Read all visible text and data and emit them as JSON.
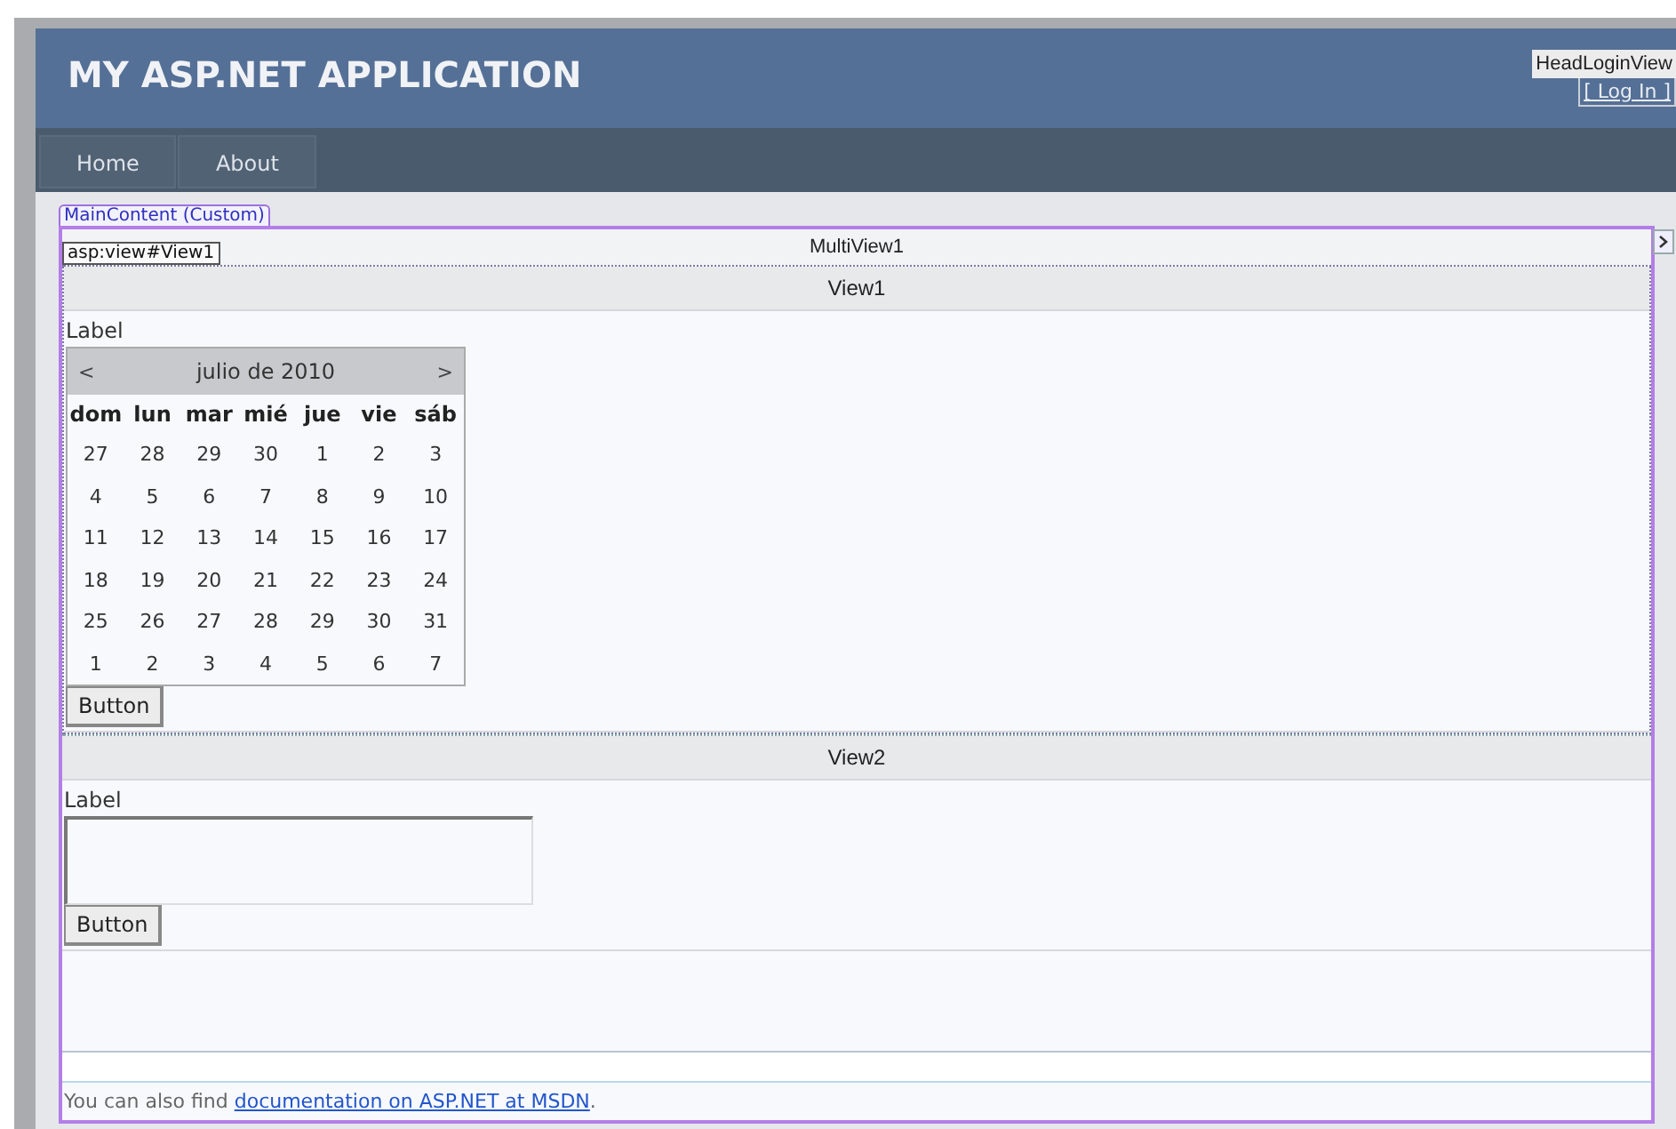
{
  "header": {
    "title": "MY ASP.NET APPLICATION",
    "login_view": {
      "tag": "HeadLoginView",
      "link": "[ Log In ]"
    }
  },
  "nav": [
    {
      "label": "Home"
    },
    {
      "label": "About"
    }
  ],
  "content_tag": "MainContent (Custom)",
  "multiview": {
    "title": "MultiView1",
    "tag": "asp:view#View1",
    "views": [
      {
        "title": "View1",
        "items": [
          {
            "kind": "label",
            "text": "Label"
          },
          {
            "kind": "calendar",
            "prev": "<",
            "month": "julio de 2010",
            "next": ">",
            "days": [
              "dom",
              "lun",
              "mar",
              "mié",
              "jue",
              "vie",
              "sáb"
            ],
            "weeks": [
              [
                "27",
                "28",
                "29",
                "30",
                "1",
                "2",
                "3"
              ],
              [
                "4",
                "5",
                "6",
                "7",
                "8",
                "9",
                "10"
              ],
              [
                "11",
                "12",
                "13",
                "14",
                "15",
                "16",
                "17"
              ],
              [
                "18",
                "19",
                "20",
                "21",
                "22",
                "23",
                "24"
              ],
              [
                "25",
                "26",
                "27",
                "28",
                "29",
                "30",
                "31"
              ],
              [
                "1",
                "2",
                "3",
                "4",
                "5",
                "6",
                "7"
              ]
            ]
          },
          {
            "kind": "button",
            "label": "Button"
          }
        ]
      },
      {
        "title": "View2",
        "items": [
          {
            "kind": "label",
            "text": "Label"
          },
          {
            "kind": "textarea"
          },
          {
            "kind": "button",
            "label": "Button"
          }
        ]
      }
    ]
  },
  "footer": {
    "before": "You can also find ",
    "link": "documentation on ASP.NET at MSDN",
    "after": "."
  }
}
